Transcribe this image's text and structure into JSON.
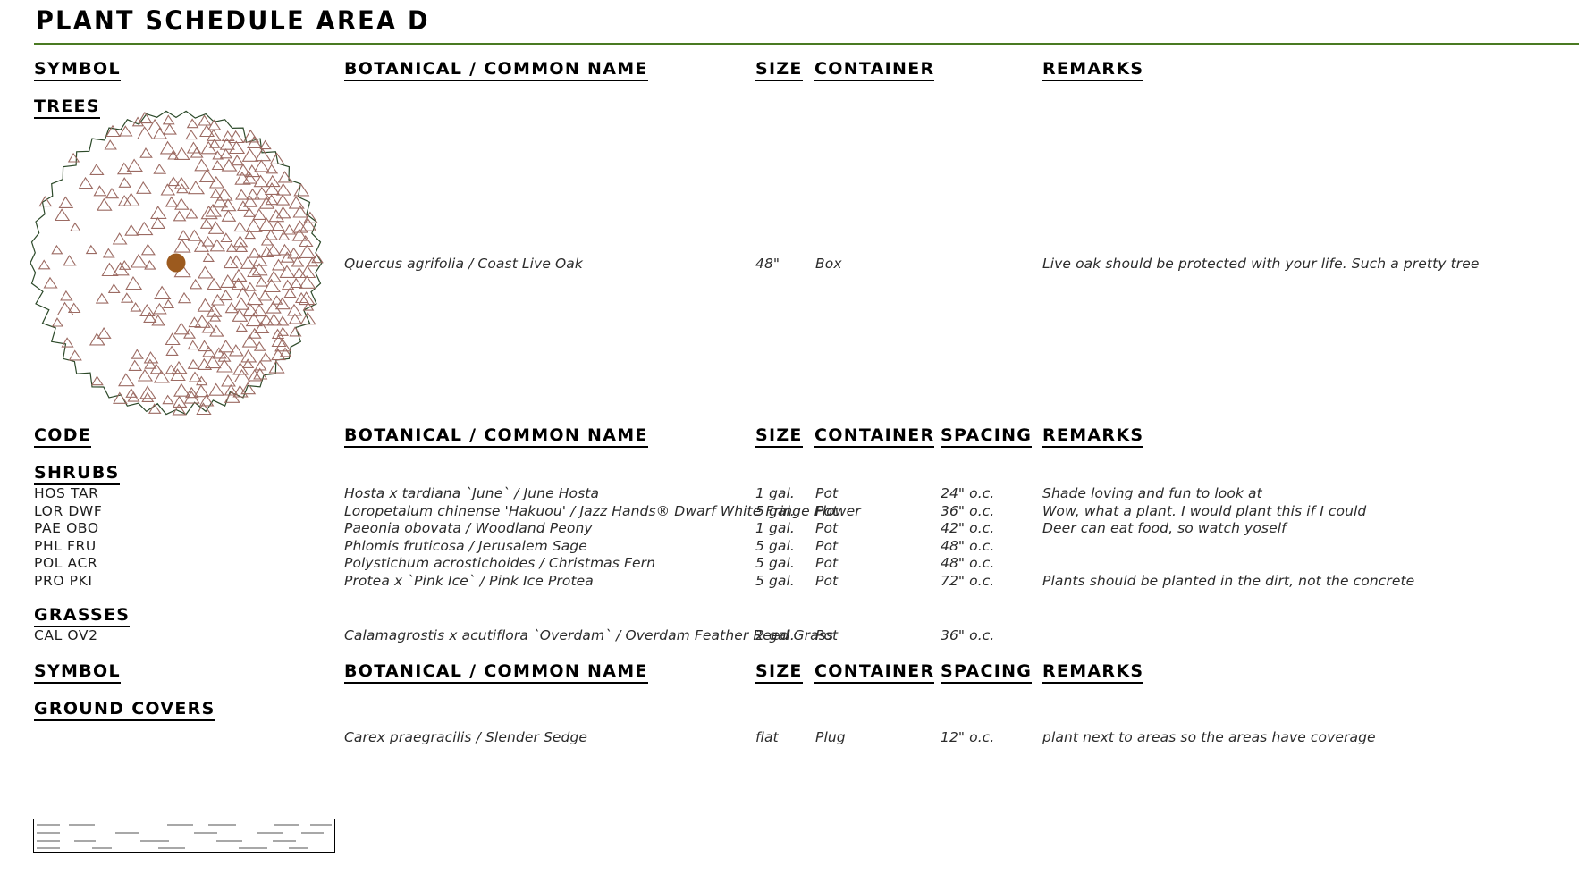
{
  "title": "PLANT SCHEDULE AREA D",
  "accent_color": "#4a7a22",
  "symbol_colors": {
    "canopy_outline": "#2d4a2a",
    "leaf_triangle": "#9c6b63",
    "trunk": "#9c5a1e",
    "groundcover_hatch": "#8c8c8c",
    "groundcover_border": "#000000"
  },
  "header_rows": {
    "trees": {
      "symbol": "SYMBOL",
      "name": "BOTANICAL / COMMON NAME",
      "size": "SIZE",
      "container": "CONTAINER",
      "remarks": "REMARKS"
    },
    "shrubs": {
      "code": "CODE",
      "name": "BOTANICAL / COMMON NAME",
      "size": "SIZE",
      "container": "CONTAINER",
      "spacing": "SPACING",
      "remarks": "REMARKS"
    },
    "groundcovers": {
      "symbol": "SYMBOL",
      "name": "BOTANICAL / COMMON NAME",
      "size": "SIZE",
      "container": "CONTAINER",
      "spacing": "SPACING",
      "remarks": "REMARKS"
    }
  },
  "groups": {
    "trees_label": "TREES",
    "shrubs_label": "SHRUBS",
    "grasses_label": "GRASSES",
    "groundcovers_label": "GROUND COVERS"
  },
  "trees": [
    {
      "name": "Quercus agrifolia / Coast Live Oak",
      "size": "48\"",
      "container": "Box",
      "remarks": "Live oak should be protected with your life. Such a pretty tree"
    }
  ],
  "shrubs": [
    {
      "code": "HOS TAR",
      "name": "Hosta x tardiana `June` / June Hosta",
      "size": "1 gal.",
      "container": "Pot",
      "spacing": "24\" o.c.",
      "remarks": "Shade loving and fun to look at"
    },
    {
      "code": "LOR DWF",
      "name": "Loropetalum chinense 'Hakuou' / Jazz Hands® Dwarf White Fringe Flower",
      "size": "5 gal.",
      "container": "Pot",
      "spacing": "36\" o.c.",
      "remarks": "Wow, what a plant. I would plant this if I could"
    },
    {
      "code": "PAE OBO",
      "name": "Paeonia obovata / Woodland Peony",
      "size": "1 gal.",
      "container": "Pot",
      "spacing": "42\" o.c.",
      "remarks": "Deer can eat food, so watch yoself"
    },
    {
      "code": "PHL FRU",
      "name": "Phlomis fruticosa / Jerusalem Sage",
      "size": "5 gal.",
      "container": "Pot",
      "spacing": "48\" o.c.",
      "remarks": ""
    },
    {
      "code": "POL ACR",
      "name": "Polystichum acrostichoides / Christmas Fern",
      "size": "5 gal.",
      "container": "Pot",
      "spacing": "48\" o.c.",
      "remarks": ""
    },
    {
      "code": "PRO PKI",
      "name": "Protea x `Pink Ice` / Pink Ice Protea",
      "size": "5 gal.",
      "container": "Pot",
      "spacing": "72\" o.c.",
      "remarks": "Plants should be planted in the dirt, not the concrete"
    }
  ],
  "grasses": [
    {
      "code": "CAL OV2",
      "name": "Calamagrostis x acutiflora `Overdam` / Overdam Feather Reed Grass",
      "size": "2 gal.",
      "container": "Pot",
      "spacing": "36\" o.c.",
      "remarks": ""
    }
  ],
  "groundcovers": [
    {
      "name": "Carex praegracilis / Slender Sedge",
      "size": "flat",
      "container": "Plug",
      "spacing": "12\" o.c.",
      "remarks": "plant next to areas so the areas have coverage"
    }
  ]
}
